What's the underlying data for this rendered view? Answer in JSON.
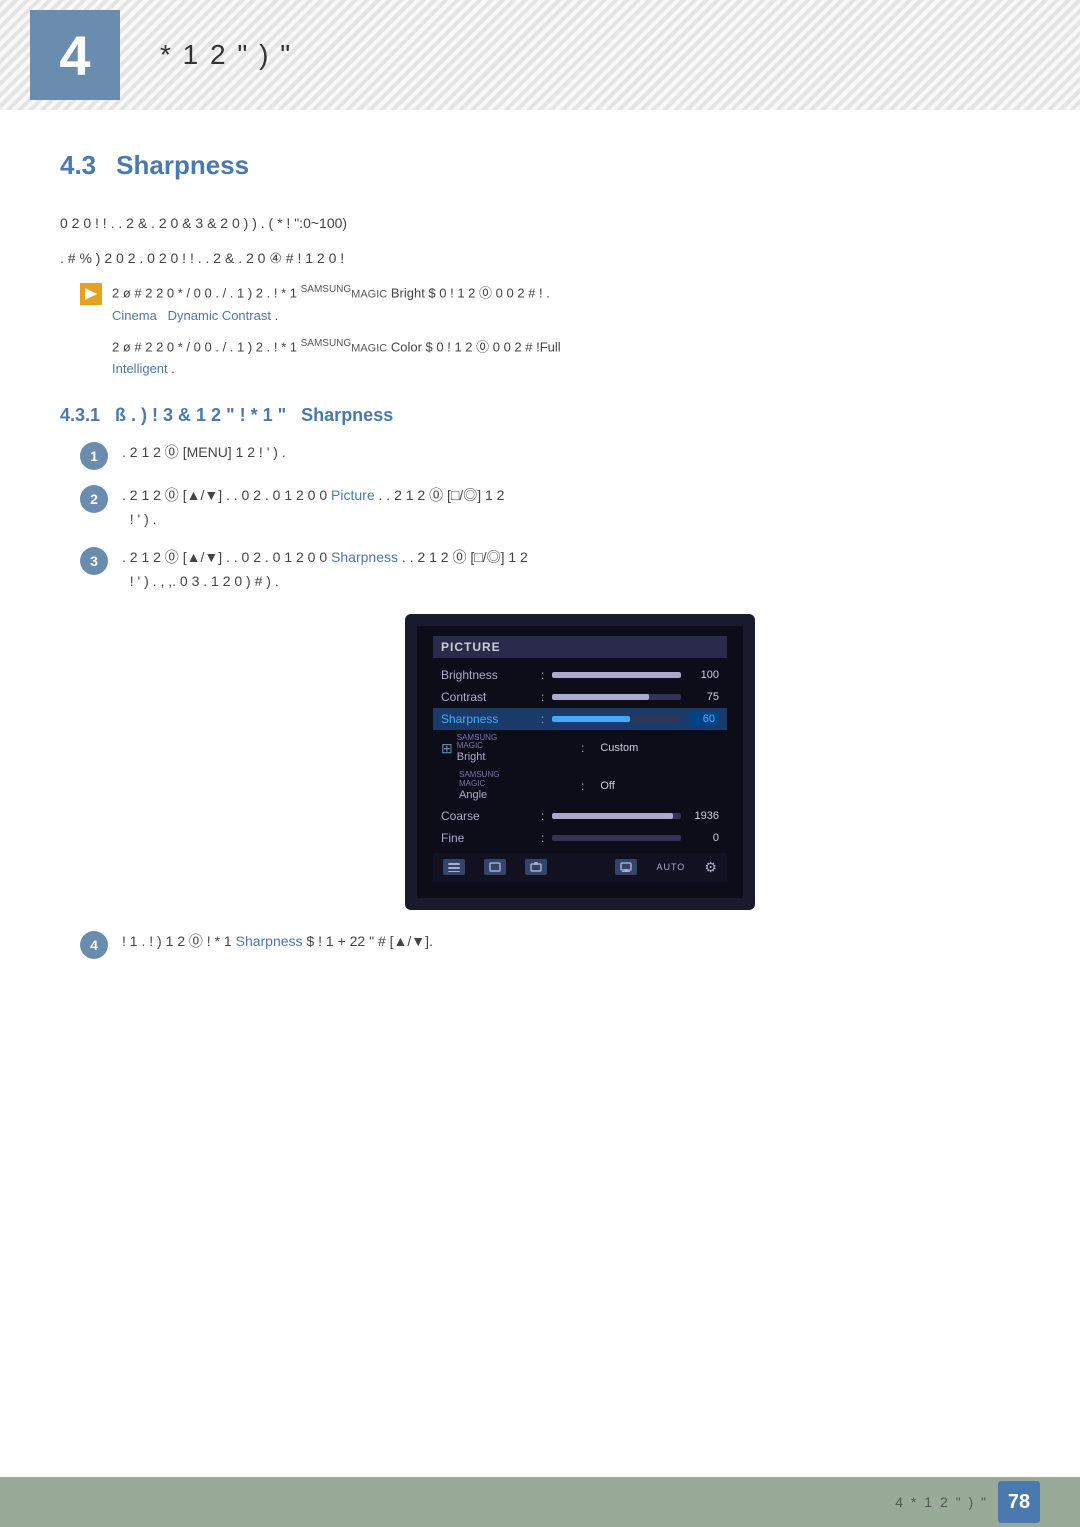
{
  "header": {
    "chapter_number": "4",
    "title": "*  1 2 \"  )  \""
  },
  "section": {
    "number": "4.3",
    "title": "Sharpness"
  },
  "body": {
    "para1": "0 2  0 !  ! .  . 2 & .  2  0    &  3 & 2 0  )     ) . (  * !  \":0~100)",
    "para2": ". # %   ) 2 0 2  .    0 2  0 !  ! .  . 2 & .  2  0   ④ #  !   1 2 0 !",
    "note1_prefix": "2   ø # 2 2  0  * / 0 0  . / .  1  ) 2 .  ! *   1",
    "note1_brand": "SAMSUNG",
    "note1_brand2": "MAGIC",
    "note1_suffix": "Bright  $ 0 !  1 2 ⓪ 0  0 2  # !  .",
    "note1_blue1": "Cinema",
    "note1_blue2": "Dynamic Contrast",
    "note2_prefix": "2   ø # 2 2  0  * / 0 0  . / .  1  ) 2 .  ! *   1",
    "note2_brand": "SAMSUNG",
    "note2_brand2": "MAGIC",
    "note2_suffix": "Color  $ 0 !  1 2 ⓪ 0 0 2  # !Full",
    "note2_blue": "Intelligent"
  },
  "subsection": {
    "number": "4.3.1",
    "title_prefix": "ß  .  ) ! 3 & 1 2  \" ! *    1  \"",
    "title_highlight": "Sharpness"
  },
  "steps": [
    {
      "number": "1",
      "text": ". 2  1 2 ⓪ [MENU] 1 2  ! ' ) ."
    },
    {
      "number": "2",
      "text": ". 2  1 2 ⓪ [▲/▼]   . .  0 2 .   0 1 2 0 0    Picture  .  . 2  1 2 ⓪ [□/◎] 1 2  ! ' ) ."
    },
    {
      "number": "3",
      "text": ". 2  1 2 ⓪ [▲/▼]   . .  0 2 .   0 1 2 0 0    Sharpness  .  . 2  1 2 ⓪ [□/◎] 1 2  ! ' ) . , ,. 0 3 .   1 2 0  )   #    ) ."
    },
    {
      "number": "4",
      "text": "!  1 . !  ) 1 2 ⓪  ! *    1  Sharpness  $ !  1    +  22 \"  #   [▲/▼]."
    }
  ],
  "monitor": {
    "header": "PICTURE",
    "menu_items": [
      {
        "label": "Brightness",
        "value": 100,
        "max": 100,
        "type": "bar"
      },
      {
        "label": "Contrast",
        "value": 75,
        "max": 100,
        "type": "bar"
      },
      {
        "label": "Sharpness",
        "value": 60,
        "max": 100,
        "type": "bar_active",
        "display": "60"
      },
      {
        "label": "SAMSUNG MAGIC Bright",
        "value": "Custom",
        "type": "text"
      },
      {
        "label": "SAMSUNG MAGIC Angle",
        "value": "Off",
        "type": "text"
      },
      {
        "label": "Coarse",
        "value": 1936,
        "max": 2048,
        "type": "bar"
      },
      {
        "label": "Fine",
        "value": 0,
        "max": 100,
        "type": "bar"
      }
    ]
  },
  "footer": {
    "text": "4  *   1 2 \"  )  \"",
    "page_number": "78"
  }
}
